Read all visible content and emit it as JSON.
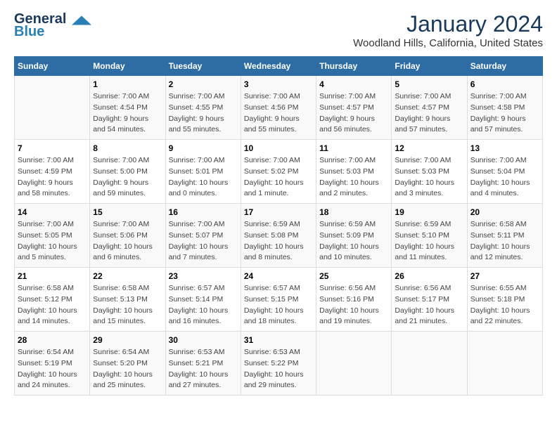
{
  "header": {
    "logo_line1": "General",
    "logo_line2": "Blue",
    "month": "January 2024",
    "location": "Woodland Hills, California, United States"
  },
  "days_of_week": [
    "Sunday",
    "Monday",
    "Tuesday",
    "Wednesday",
    "Thursday",
    "Friday",
    "Saturday"
  ],
  "weeks": [
    [
      {
        "num": "",
        "info": ""
      },
      {
        "num": "1",
        "info": "Sunrise: 7:00 AM\nSunset: 4:54 PM\nDaylight: 9 hours\nand 54 minutes."
      },
      {
        "num": "2",
        "info": "Sunrise: 7:00 AM\nSunset: 4:55 PM\nDaylight: 9 hours\nand 55 minutes."
      },
      {
        "num": "3",
        "info": "Sunrise: 7:00 AM\nSunset: 4:56 PM\nDaylight: 9 hours\nand 55 minutes."
      },
      {
        "num": "4",
        "info": "Sunrise: 7:00 AM\nSunset: 4:57 PM\nDaylight: 9 hours\nand 56 minutes."
      },
      {
        "num": "5",
        "info": "Sunrise: 7:00 AM\nSunset: 4:57 PM\nDaylight: 9 hours\nand 57 minutes."
      },
      {
        "num": "6",
        "info": "Sunrise: 7:00 AM\nSunset: 4:58 PM\nDaylight: 9 hours\nand 57 minutes."
      }
    ],
    [
      {
        "num": "7",
        "info": "Sunrise: 7:00 AM\nSunset: 4:59 PM\nDaylight: 9 hours\nand 58 minutes."
      },
      {
        "num": "8",
        "info": "Sunrise: 7:00 AM\nSunset: 5:00 PM\nDaylight: 9 hours\nand 59 minutes."
      },
      {
        "num": "9",
        "info": "Sunrise: 7:00 AM\nSunset: 5:01 PM\nDaylight: 10 hours\nand 0 minutes."
      },
      {
        "num": "10",
        "info": "Sunrise: 7:00 AM\nSunset: 5:02 PM\nDaylight: 10 hours\nand 1 minute."
      },
      {
        "num": "11",
        "info": "Sunrise: 7:00 AM\nSunset: 5:03 PM\nDaylight: 10 hours\nand 2 minutes."
      },
      {
        "num": "12",
        "info": "Sunrise: 7:00 AM\nSunset: 5:03 PM\nDaylight: 10 hours\nand 3 minutes."
      },
      {
        "num": "13",
        "info": "Sunrise: 7:00 AM\nSunset: 5:04 PM\nDaylight: 10 hours\nand 4 minutes."
      }
    ],
    [
      {
        "num": "14",
        "info": "Sunrise: 7:00 AM\nSunset: 5:05 PM\nDaylight: 10 hours\nand 5 minutes."
      },
      {
        "num": "15",
        "info": "Sunrise: 7:00 AM\nSunset: 5:06 PM\nDaylight: 10 hours\nand 6 minutes."
      },
      {
        "num": "16",
        "info": "Sunrise: 7:00 AM\nSunset: 5:07 PM\nDaylight: 10 hours\nand 7 minutes."
      },
      {
        "num": "17",
        "info": "Sunrise: 6:59 AM\nSunset: 5:08 PM\nDaylight: 10 hours\nand 8 minutes."
      },
      {
        "num": "18",
        "info": "Sunrise: 6:59 AM\nSunset: 5:09 PM\nDaylight: 10 hours\nand 10 minutes."
      },
      {
        "num": "19",
        "info": "Sunrise: 6:59 AM\nSunset: 5:10 PM\nDaylight: 10 hours\nand 11 minutes."
      },
      {
        "num": "20",
        "info": "Sunrise: 6:58 AM\nSunset: 5:11 PM\nDaylight: 10 hours\nand 12 minutes."
      }
    ],
    [
      {
        "num": "21",
        "info": "Sunrise: 6:58 AM\nSunset: 5:12 PM\nDaylight: 10 hours\nand 14 minutes."
      },
      {
        "num": "22",
        "info": "Sunrise: 6:58 AM\nSunset: 5:13 PM\nDaylight: 10 hours\nand 15 minutes."
      },
      {
        "num": "23",
        "info": "Sunrise: 6:57 AM\nSunset: 5:14 PM\nDaylight: 10 hours\nand 16 minutes."
      },
      {
        "num": "24",
        "info": "Sunrise: 6:57 AM\nSunset: 5:15 PM\nDaylight: 10 hours\nand 18 minutes."
      },
      {
        "num": "25",
        "info": "Sunrise: 6:56 AM\nSunset: 5:16 PM\nDaylight: 10 hours\nand 19 minutes."
      },
      {
        "num": "26",
        "info": "Sunrise: 6:56 AM\nSunset: 5:17 PM\nDaylight: 10 hours\nand 21 minutes."
      },
      {
        "num": "27",
        "info": "Sunrise: 6:55 AM\nSunset: 5:18 PM\nDaylight: 10 hours\nand 22 minutes."
      }
    ],
    [
      {
        "num": "28",
        "info": "Sunrise: 6:54 AM\nSunset: 5:19 PM\nDaylight: 10 hours\nand 24 minutes."
      },
      {
        "num": "29",
        "info": "Sunrise: 6:54 AM\nSunset: 5:20 PM\nDaylight: 10 hours\nand 25 minutes."
      },
      {
        "num": "30",
        "info": "Sunrise: 6:53 AM\nSunset: 5:21 PM\nDaylight: 10 hours\nand 27 minutes."
      },
      {
        "num": "31",
        "info": "Sunrise: 6:53 AM\nSunset: 5:22 PM\nDaylight: 10 hours\nand 29 minutes."
      },
      {
        "num": "",
        "info": ""
      },
      {
        "num": "",
        "info": ""
      },
      {
        "num": "",
        "info": ""
      }
    ]
  ]
}
